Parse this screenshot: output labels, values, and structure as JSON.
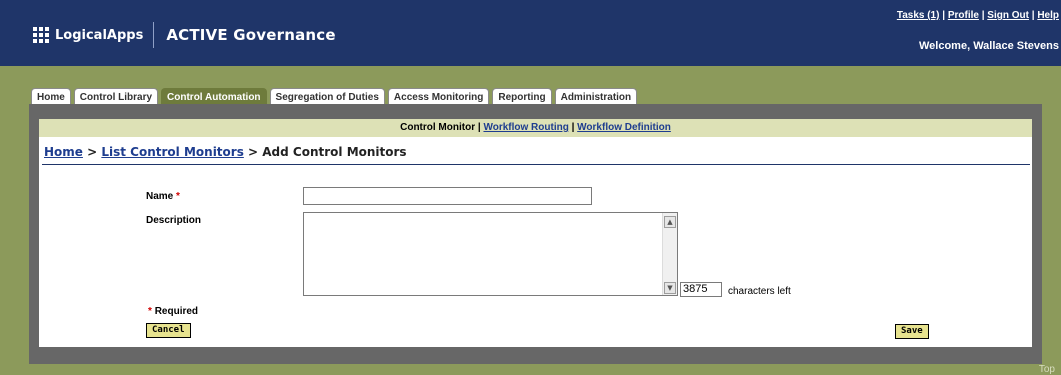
{
  "header": {
    "logo_text": "LogicalApps",
    "product_name": "ACTIVE Governance",
    "links": {
      "tasks": "Tasks (1)",
      "profile": "Profile",
      "sign_out": "Sign Out",
      "help": "Help",
      "separator": " | "
    },
    "welcome": "Welcome, Wallace Stevens"
  },
  "tabs": [
    {
      "label": "Home"
    },
    {
      "label": "Control Library"
    },
    {
      "label": "Control Automation"
    },
    {
      "label": "Segregation of Duties"
    },
    {
      "label": "Access Monitoring"
    },
    {
      "label": "Reporting"
    },
    {
      "label": "Administration"
    }
  ],
  "subnav": {
    "current": "Control Monitor",
    "separator": " | ",
    "link1": "Workflow Routing",
    "link2": "Workflow Definition"
  },
  "breadcrumb": {
    "home": "Home",
    "sep1": " > ",
    "list": "List Control Monitors",
    "sep2": " > ",
    "current": "Add Control Monitors"
  },
  "form": {
    "name_label": "Name",
    "required_marker": "*",
    "name_value": "",
    "description_label": "Description",
    "description_value": "",
    "chars_left_value": "3875",
    "chars_left_label": "characters left",
    "required_note": "Required"
  },
  "buttons": {
    "cancel": "Cancel",
    "save": "Save"
  },
  "footer": {
    "top_link": "Top"
  },
  "colors": {
    "header_bg": "#1f3569",
    "olive": "#8c9a5b",
    "active_tab": "#6e7b3c",
    "subnav_bg": "#dde1b6",
    "button_bg": "#e7e38f",
    "required_red": "#d00000"
  }
}
